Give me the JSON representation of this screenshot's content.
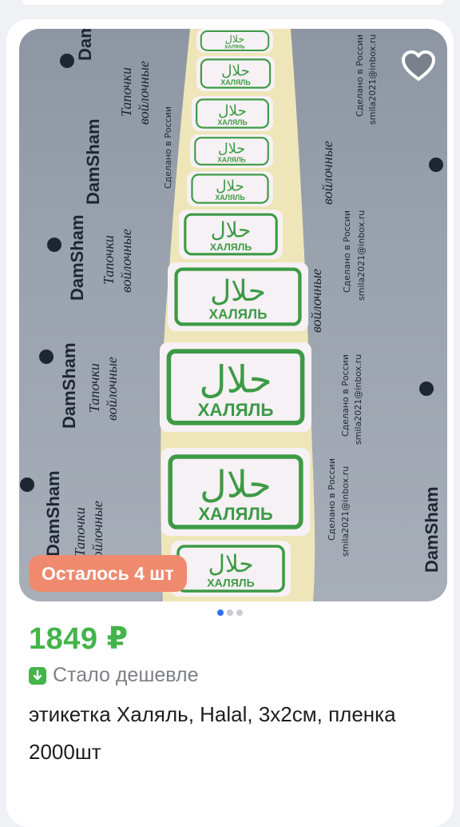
{
  "product": {
    "stock_badge": "Осталось 4 шт",
    "price": "1849 ₽",
    "price_note": "Стало дешевле",
    "title": "этикетка Халяль, Halal, 3х2см, пленка 2000шт",
    "carousel": {
      "total": 3,
      "active": 1
    }
  },
  "photo": {
    "label_arabic": "حلال",
    "label_cyrillic": "ХАЛЯЛЬ",
    "bg_brand": "DamSham",
    "bg_product": [
      "Тапочки",
      "войлочные"
    ],
    "bg_made": "Сделано в России",
    "bg_email": "smila2021@inbox.ru"
  },
  "colors": {
    "price": "#43b44a",
    "badge": "#ef8a6f",
    "dot_active": "#2d6ff0",
    "label_green": "#3d9a45"
  },
  "icons": {
    "favorite": "heart-outline-icon",
    "price_down": "arrow-down-icon"
  }
}
